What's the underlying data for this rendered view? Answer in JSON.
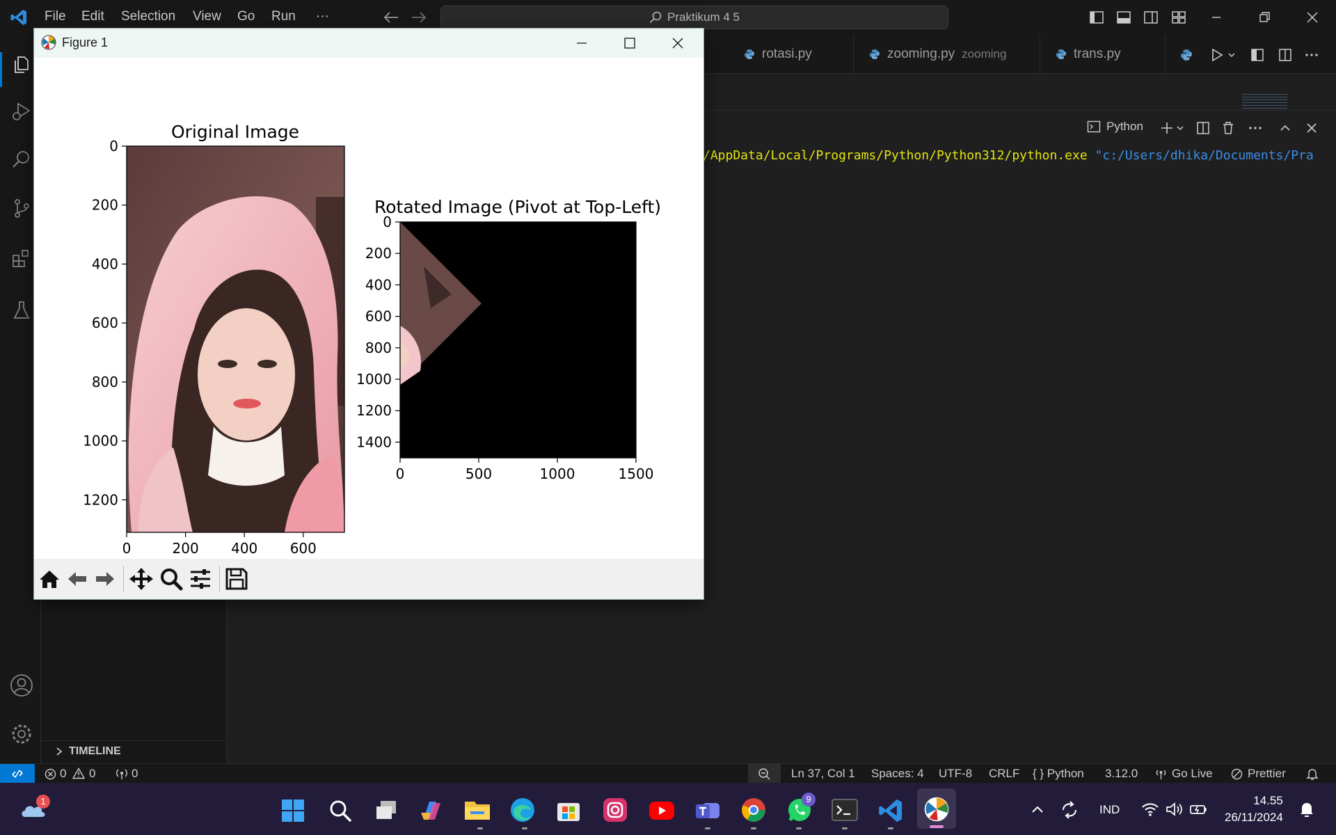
{
  "titlebar": {
    "menu": [
      "File",
      "Edit",
      "Selection",
      "View",
      "Go",
      "Run",
      "···"
    ],
    "search_text": "Praktikum 4 5"
  },
  "tabs": [
    {
      "label": "rotasi.py",
      "desc": ""
    },
    {
      "label": "zooming.py",
      "desc": "zooming"
    },
    {
      "label": "trans.py",
      "desc": ""
    }
  ],
  "terminal": {
    "profile_label": "Python",
    "line_path": "/AppData/Local/Programs/Python/Python312/python.exe",
    "line_arg": " \"c:/Users/dhika/Documents/Pra"
  },
  "sidebar": {
    "timeline_label": "TIMELINE"
  },
  "statusbar": {
    "errors": "0",
    "warnings": "0",
    "ports": "0",
    "position": "Ln 37, Col 1",
    "spaces": "Spaces: 4",
    "encoding": "UTF-8",
    "eol": "CRLF",
    "language": "{ } Python",
    "version": "3.12.0",
    "golive": "Go Live",
    "prettier": "Prettier"
  },
  "taskbar": {
    "onedrive_badge": "1",
    "whatsapp_badge": "9",
    "lang": "IND",
    "time": "14.55",
    "date": "26/11/2024"
  },
  "figure": {
    "window_title": "Figure 1",
    "chart_data": [
      {
        "type": "image",
        "title": "Original Image",
        "x_ticks": [
          0,
          200,
          400,
          600
        ],
        "y_ticks": [
          0,
          200,
          400,
          600,
          800,
          1000,
          1200
        ],
        "xlim": [
          0,
          740
        ],
        "ylim": [
          1310,
          0
        ]
      },
      {
        "type": "image",
        "title": "Rotated Image (Pivot at Top-Left)",
        "x_ticks": [
          0,
          500,
          1000,
          1500
        ],
        "y_ticks": [
          0,
          200,
          400,
          600,
          800,
          1000,
          1200,
          1400
        ],
        "xlim": [
          0,
          1500
        ],
        "ylim": [
          1500,
          0
        ]
      }
    ]
  },
  "colors": {
    "accent": "#0078d4",
    "terminal_yellow": "#e5e510",
    "terminal_blue": "#3b8eea"
  }
}
